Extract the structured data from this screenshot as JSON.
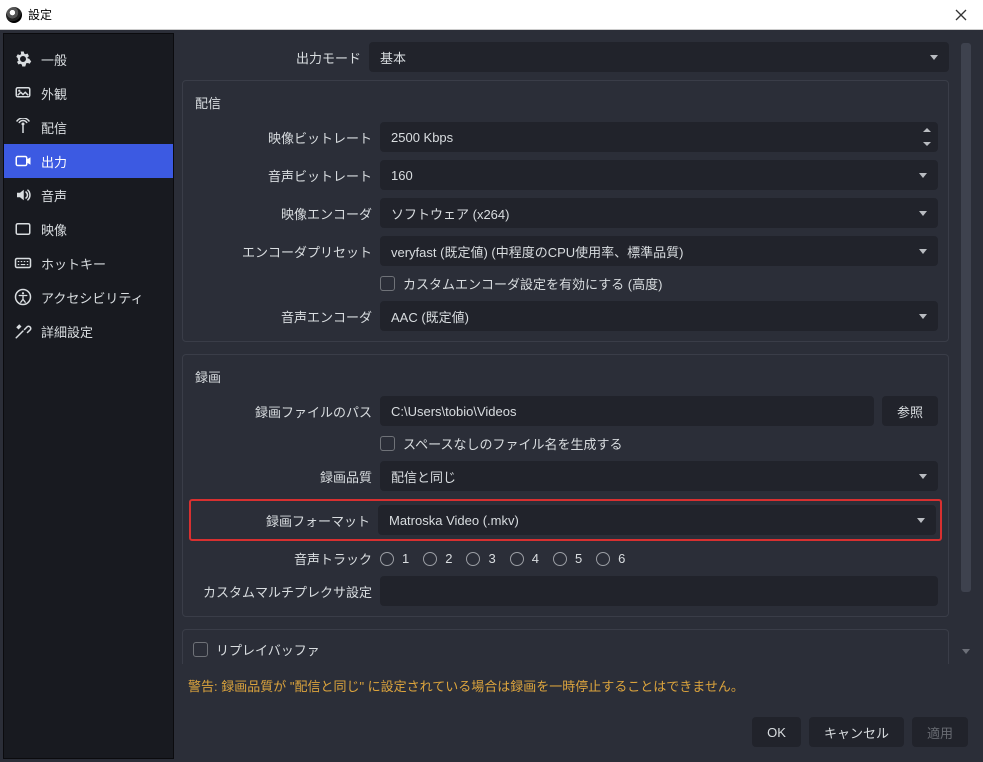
{
  "window": {
    "title": "設定"
  },
  "sidebar": {
    "items": [
      {
        "label": "一般"
      },
      {
        "label": "外観"
      },
      {
        "label": "配信"
      },
      {
        "label": "出力"
      },
      {
        "label": "音声"
      },
      {
        "label": "映像"
      },
      {
        "label": "ホットキー"
      },
      {
        "label": "アクセシビリティ"
      },
      {
        "label": "詳細設定"
      }
    ]
  },
  "top": {
    "output_mode_label": "出力モード",
    "output_mode_value": "基本"
  },
  "streaming": {
    "title": "配信",
    "video_bitrate_label": "映像ビットレート",
    "video_bitrate_value": "2500 Kbps",
    "audio_bitrate_label": "音声ビットレート",
    "audio_bitrate_value": "160",
    "video_encoder_label": "映像エンコーダ",
    "video_encoder_value": "ソフトウェア (x264)",
    "encoder_preset_label": "エンコーダプリセット",
    "encoder_preset_value": "veryfast (既定値) (中程度のCPU使用率、標準品質)",
    "custom_encoder_checkbox": "カスタムエンコーダ設定を有効にする (高度)",
    "audio_encoder_label": "音声エンコーダ",
    "audio_encoder_value": "AAC (既定値)"
  },
  "recording": {
    "title": "録画",
    "path_label": "録画ファイルのパス",
    "path_value": "C:\\Users\\tobio\\Videos",
    "browse": "参照",
    "nospace_checkbox": "スペースなしのファイル名を生成する",
    "quality_label": "録画品質",
    "quality_value": "配信と同じ",
    "format_label": "録画フォーマット",
    "format_value": "Matroska Video (.mkv)",
    "audio_track_label": "音声トラック",
    "tracks": [
      "1",
      "2",
      "3",
      "4",
      "5",
      "6"
    ],
    "custom_mux_label": "カスタムマルチプレクサ設定",
    "custom_mux_value": ""
  },
  "replay": {
    "title": "リプレイバッファ"
  },
  "warning": "警告: 録画品質が \"配信と同じ\" に設定されている場合は録画を一時停止することはできません。",
  "footer": {
    "ok": "OK",
    "cancel": "キャンセル",
    "apply": "適用"
  }
}
